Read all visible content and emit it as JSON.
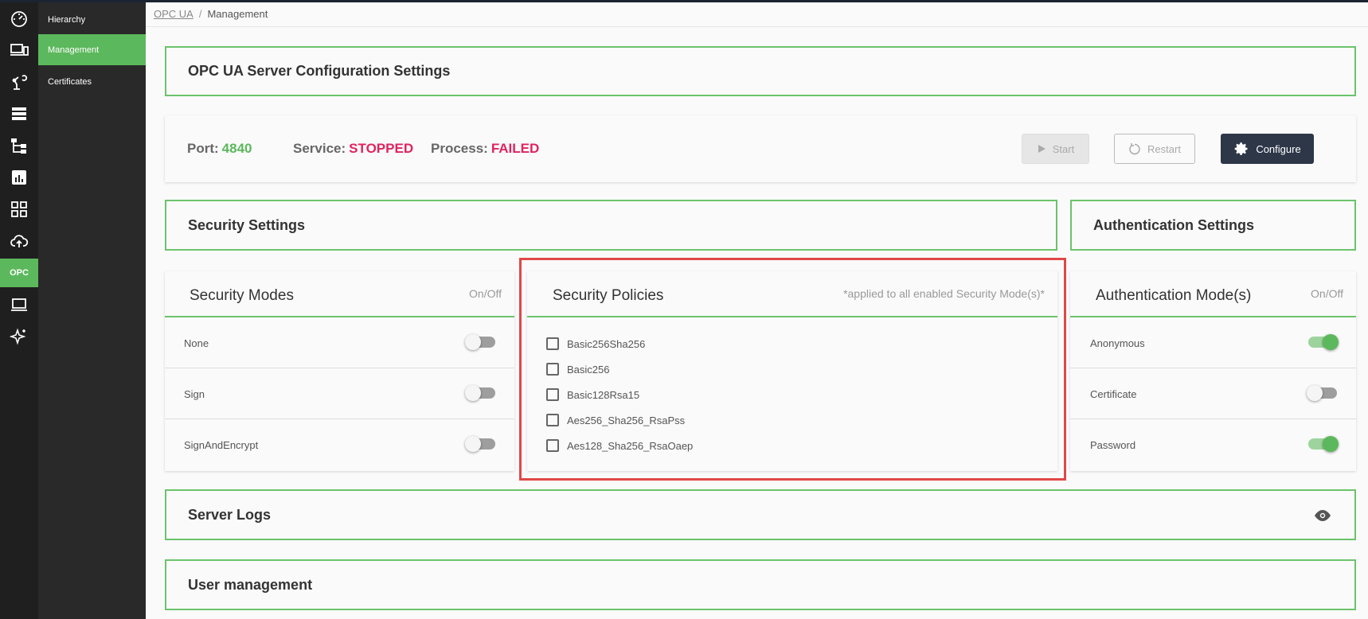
{
  "rail": {
    "opc_label": "OPC"
  },
  "subnav": {
    "items": [
      {
        "label": "Hierarchy"
      },
      {
        "label": "Management"
      },
      {
        "label": "Certificates"
      }
    ]
  },
  "breadcrumb": {
    "root": "OPC UA",
    "separator": "/",
    "current": "Management"
  },
  "server_config": {
    "title": "OPC UA Server Configuration Settings"
  },
  "status": {
    "port_label": "Port:",
    "port_value": "4840",
    "service_label": "Service:",
    "service_value": "STOPPED",
    "process_label": "Process:",
    "process_value": "FAILED",
    "start_label": "Start",
    "restart_label": "Restart",
    "configure_label": "Configure"
  },
  "security_settings": {
    "title": "Security Settings"
  },
  "auth_settings": {
    "title": "Authentication Settings"
  },
  "security_modes": {
    "title": "Security Modes",
    "hint": "On/Off",
    "modes": [
      {
        "label": "None",
        "on": false
      },
      {
        "label": "Sign",
        "on": false
      },
      {
        "label": "SignAndEncrypt",
        "on": false
      }
    ]
  },
  "security_policies": {
    "title": "Security Policies",
    "hint": "*applied to all enabled Security Mode(s)*",
    "policies": [
      {
        "label": "Basic256Sha256",
        "checked": false
      },
      {
        "label": "Basic256",
        "checked": false
      },
      {
        "label": "Basic128Rsa15",
        "checked": false
      },
      {
        "label": "Aes256_Sha256_RsaPss",
        "checked": false
      },
      {
        "label": "Aes128_Sha256_RsaOaep",
        "checked": false
      }
    ]
  },
  "auth_modes": {
    "title": "Authentication Mode(s)",
    "hint": "On/Off",
    "modes": [
      {
        "label": "Anonymous",
        "on": true
      },
      {
        "label": "Certificate",
        "on": false
      },
      {
        "label": "Password",
        "on": true
      }
    ]
  },
  "server_logs": {
    "title": "Server Logs"
  },
  "user_management": {
    "title": "User management"
  },
  "colors": {
    "accent": "#5cb85c",
    "error": "#e0245e",
    "highlight": "#e04848",
    "configure_bg": "#2d3748"
  }
}
